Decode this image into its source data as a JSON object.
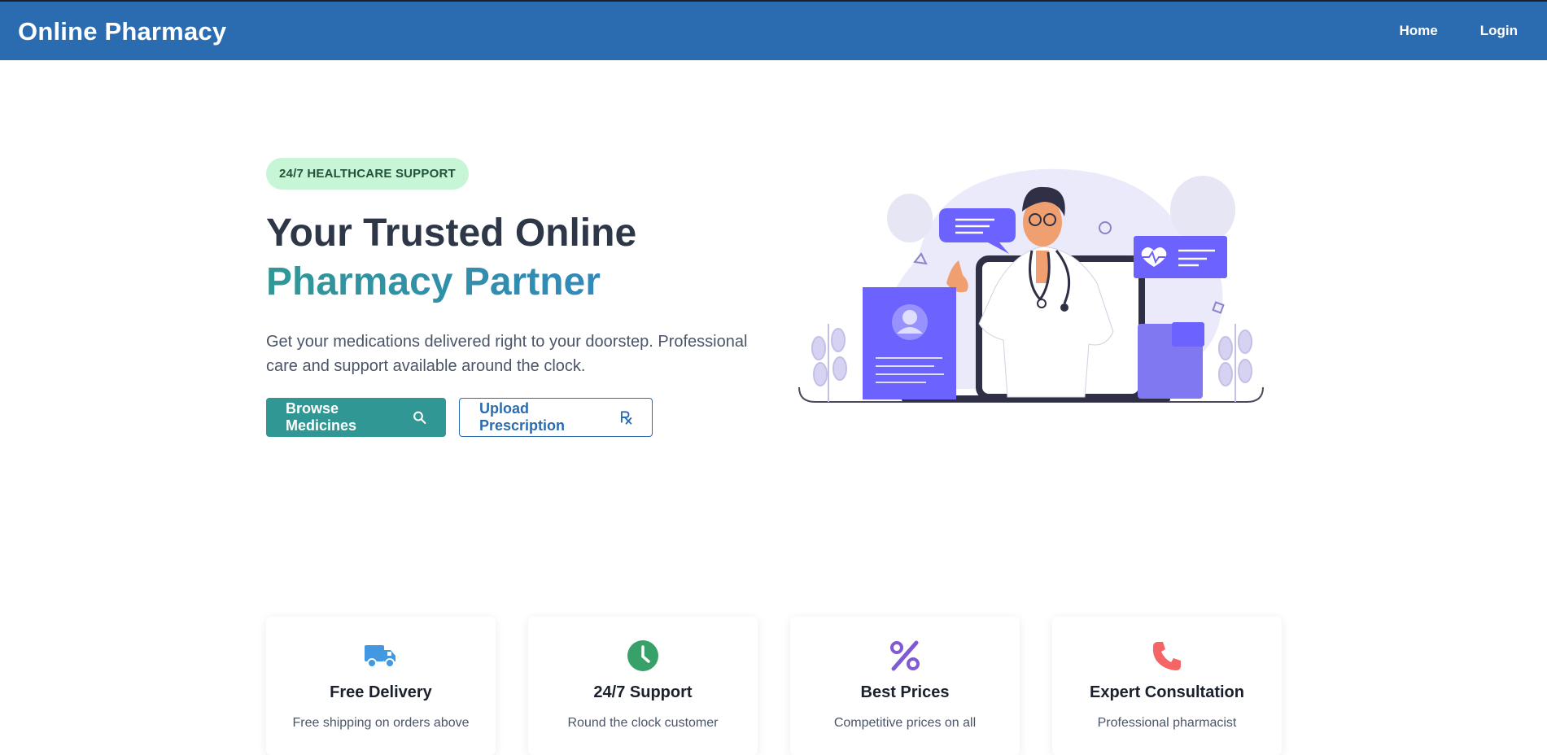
{
  "header": {
    "brand": "Online Pharmacy",
    "nav": [
      "Home",
      "Login"
    ]
  },
  "hero": {
    "badge": "24/7 HEALTHCARE SUPPORT",
    "headline_line1": "Your Trusted Online",
    "headline_line2": "Pharmacy Partner",
    "lead": "Get your medications delivered right to your doorstep. Professional care and support available around the clock.",
    "primary_button": "Browse Medicines",
    "secondary_button": "Upload Prescription"
  },
  "features": [
    {
      "icon": "truck-icon",
      "color": "#4299e1",
      "title": "Free Delivery",
      "desc": "Free shipping on orders above"
    },
    {
      "icon": "clock-icon",
      "color": "#38a169",
      "title": "24/7 Support",
      "desc": "Round the clock customer"
    },
    {
      "icon": "percent-icon",
      "color": "#805ad5",
      "title": "Best Prices",
      "desc": "Competitive prices on all"
    },
    {
      "icon": "phone-icon",
      "color": "#f56565",
      "title": "Expert Consultation",
      "desc": "Professional pharmacist"
    }
  ],
  "colors": {
    "header": "#2b6cb0",
    "primary": "#319795",
    "badge_bg": "#c6f6d5"
  }
}
